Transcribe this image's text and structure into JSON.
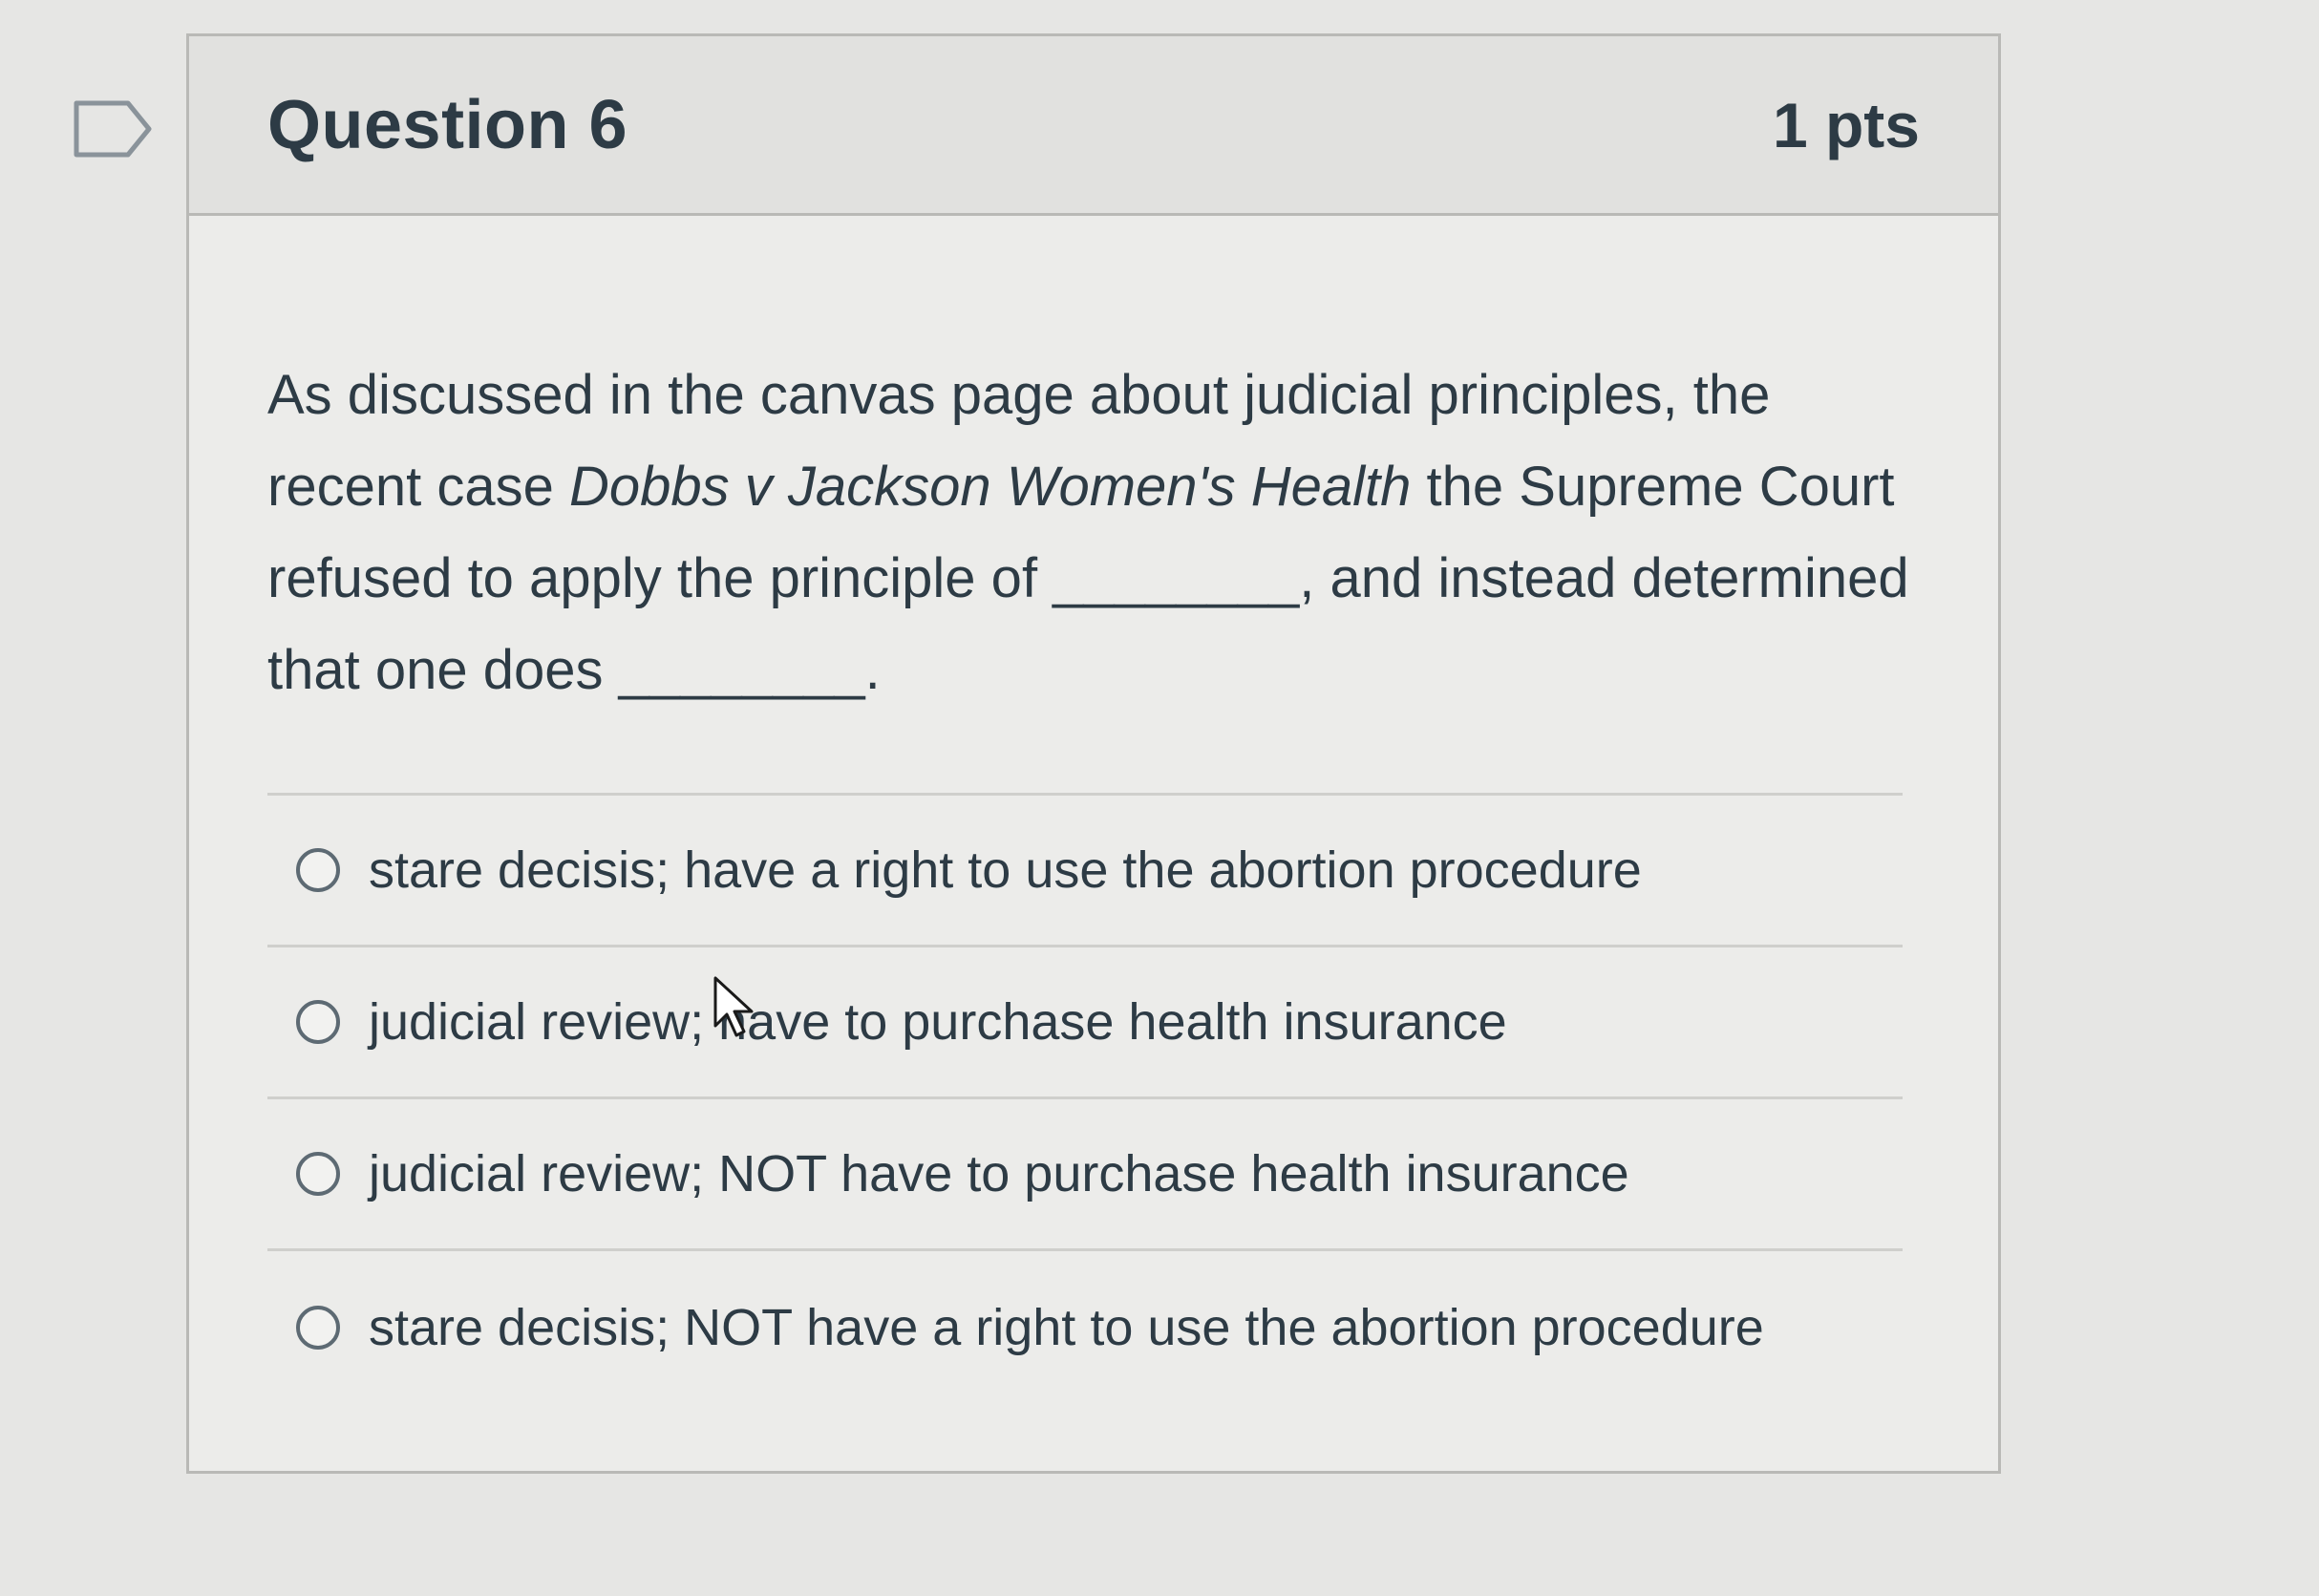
{
  "question": {
    "title": "Question 6",
    "points": "1 pts",
    "text": {
      "part1": "As discussed in the canvas page about judicial principles, the recent case ",
      "case_name": "Dobbs v Jackson Women's Health",
      "part2": " the Supreme Court refused to apply the principle of ________, and instead determined that one does ________."
    },
    "answers": [
      {
        "label": "stare decisis; have a right to use the abortion procedure"
      },
      {
        "label": "judicial review; have to purchase health insurance"
      },
      {
        "label": "judicial review; NOT have to purchase health insurance"
      },
      {
        "label": "stare decisis; NOT have a right to use the abortion procedure"
      }
    ]
  },
  "icons": {
    "flag": "flag-outline-icon",
    "cursor": "mouse-pointer-icon"
  },
  "colors": {
    "text": "#2d3b45",
    "border": "#b9b9b6",
    "header_bg": "#e1e1df",
    "page_bg": "#e6e6e4"
  }
}
